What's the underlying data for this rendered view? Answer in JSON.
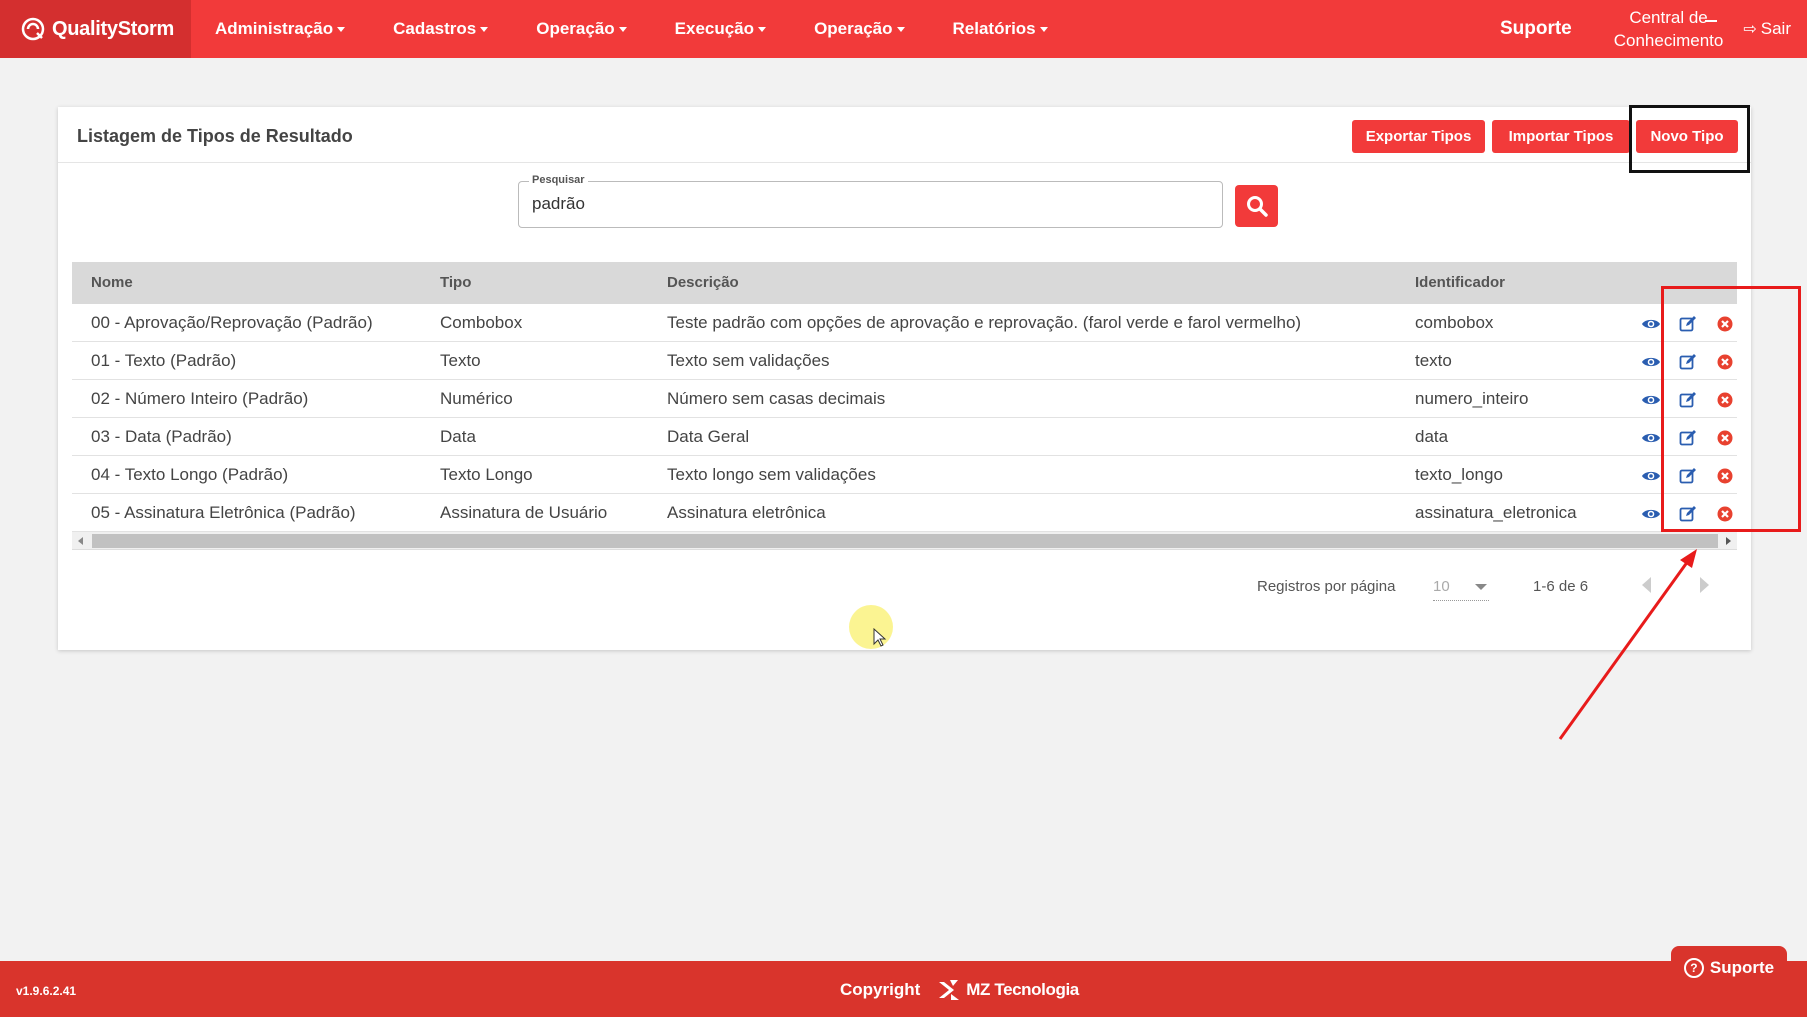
{
  "app": {
    "logo_text": "QualityStorm"
  },
  "nav": {
    "items": [
      {
        "label": "Administração"
      },
      {
        "label": "Cadastros"
      },
      {
        "label": "Operação"
      },
      {
        "label": "Execução"
      },
      {
        "label": "Operação"
      },
      {
        "label": "Relatórios"
      }
    ],
    "suporte": "Suporte",
    "central_line1": "Central de",
    "central_line2": "Conhecimento",
    "sair": "Sair"
  },
  "card": {
    "title": "Listagem de Tipos de Resultado",
    "export_label": "Exportar Tipos",
    "import_label": "Importar Tipos",
    "new_label": "Novo Tipo"
  },
  "search": {
    "label": "Pesquisar",
    "value": "padrão"
  },
  "table": {
    "headers": {
      "nome": "Nome",
      "tipo": "Tipo",
      "descricao": "Descrição",
      "identificador": "Identificador"
    },
    "rows": [
      {
        "nome": "00 - Aprovação/Reprovação (Padrão)",
        "tipo": "Combobox",
        "descricao": "Teste padrão com opções de aprovação e reprovação. (farol verde e farol vermelho)",
        "identificador": "combobox"
      },
      {
        "nome": "01 - Texto (Padrão)",
        "tipo": "Texto",
        "descricao": "Texto sem validações",
        "identificador": "texto"
      },
      {
        "nome": "02 - Número Inteiro (Padrão)",
        "tipo": "Numérico",
        "descricao": "Número sem casas decimais",
        "identificador": "numero_inteiro"
      },
      {
        "nome": "03 - Data (Padrão)",
        "tipo": "Data",
        "descricao": "Data Geral",
        "identificador": "data"
      },
      {
        "nome": "04 - Texto Longo (Padrão)",
        "tipo": "Texto Longo",
        "descricao": "Texto longo sem validações",
        "identificador": "texto_longo"
      },
      {
        "nome": "05 - Assinatura Eletrônica (Padrão)",
        "tipo": "Assinatura de Usuário",
        "descricao": "Assinatura eletrônica",
        "identificador": "assinatura_eletronica"
      }
    ],
    "row_actions": [
      "view-icon",
      "edit-icon",
      "delete-icon"
    ]
  },
  "pagination": {
    "per_page_label": "Registros por página",
    "per_page_value": "10",
    "range": "1-6 de 6"
  },
  "footer": {
    "version": "v1.9.6.2.41",
    "copyright": "Copyright",
    "company": "MZ Tecnologia",
    "suporte_button": "Suporte"
  },
  "colors": {
    "brand_red": "#f23a3a",
    "footer_red": "#d9342c",
    "icon_blue": "#2a5db0",
    "delete_red": "#e8412f"
  }
}
